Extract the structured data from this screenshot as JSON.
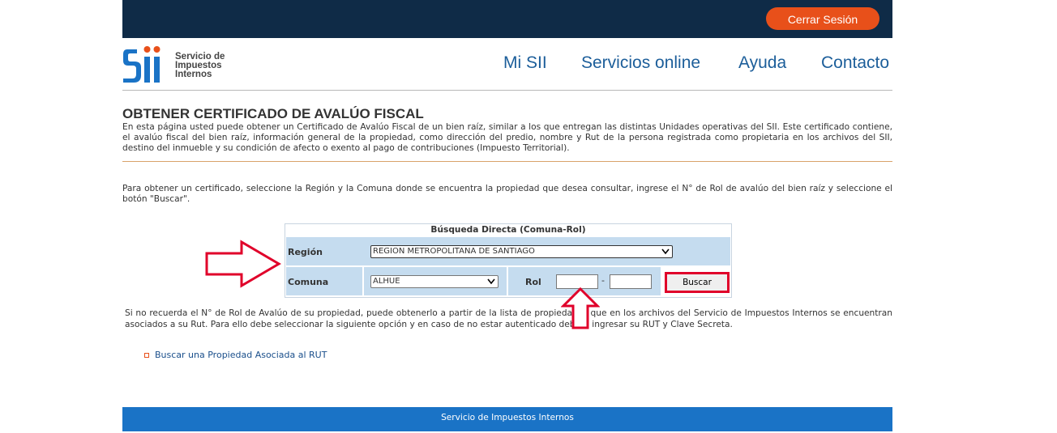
{
  "topbar": {
    "logout_label": "Cerrar Sesión"
  },
  "logo": {
    "line1": "Servicio de",
    "line2": "Impuestos",
    "line3": "Internos"
  },
  "nav": [
    {
      "label": "Mi SII"
    },
    {
      "label": "Servicios online"
    },
    {
      "label": "Ayuda"
    },
    {
      "label": "Contacto"
    }
  ],
  "page": {
    "title": "OBTENER CERTIFICADO DE AVALÚO FISCAL",
    "intro": "En esta página usted puede obtener un Certificado de Avalúo Fiscal de un bien raíz, similar a los que entregan las distintas Unidades operativas del SII. Este certificado contiene, el avalúo fiscal del bien raíz, información general de la propiedad, como dirección del predio, nombre y Rut de la persona registrada como propietaria en los archivos del SII, destino del inmueble y su condición de afecto o exento al pago de contribuciones (Impuesto Territorial).",
    "instructions": "Para obtener un certificado, seleccione la Región y la Comuna donde se encuentra la propiedad que desea consultar, ingrese el N° de Rol de avalúo del bien raíz y seleccione el botón \"Buscar\"."
  },
  "search": {
    "title": "Búsqueda Directa (Comuna-Rol)",
    "region_label": "Región",
    "region_value": "REGION METROPOLITANA DE SANTIAGO",
    "comuna_label": "Comuna",
    "comuna_value": "ALHUE",
    "rol_label": "Rol",
    "rol_separator": "-",
    "button_label": "Buscar"
  },
  "hint": "Si no recuerda el N° de Rol de Avalúo de su propiedad, puede obtenerlo a partir de la lista de propiedades que en los archivos del Servicio de Impuestos Internos se encuentran asociados a su Rut. Para ello debe seleccionar la siguiente opción y en caso de no estar autenticado deberá ingresar su RUT y Clave Secreta.",
  "link": {
    "label": "Buscar una Propiedad Asociada al RUT"
  },
  "footer": {
    "text": "Servicio de Impuestos Internos"
  },
  "colors": {
    "topbar": "#0f2b47",
    "accent_orange": "#e8501a",
    "nav_blue": "#1c5e9a",
    "footer_blue": "#1a73c6",
    "annotation_red": "#e0002a",
    "table_row": "#c5dcef"
  }
}
